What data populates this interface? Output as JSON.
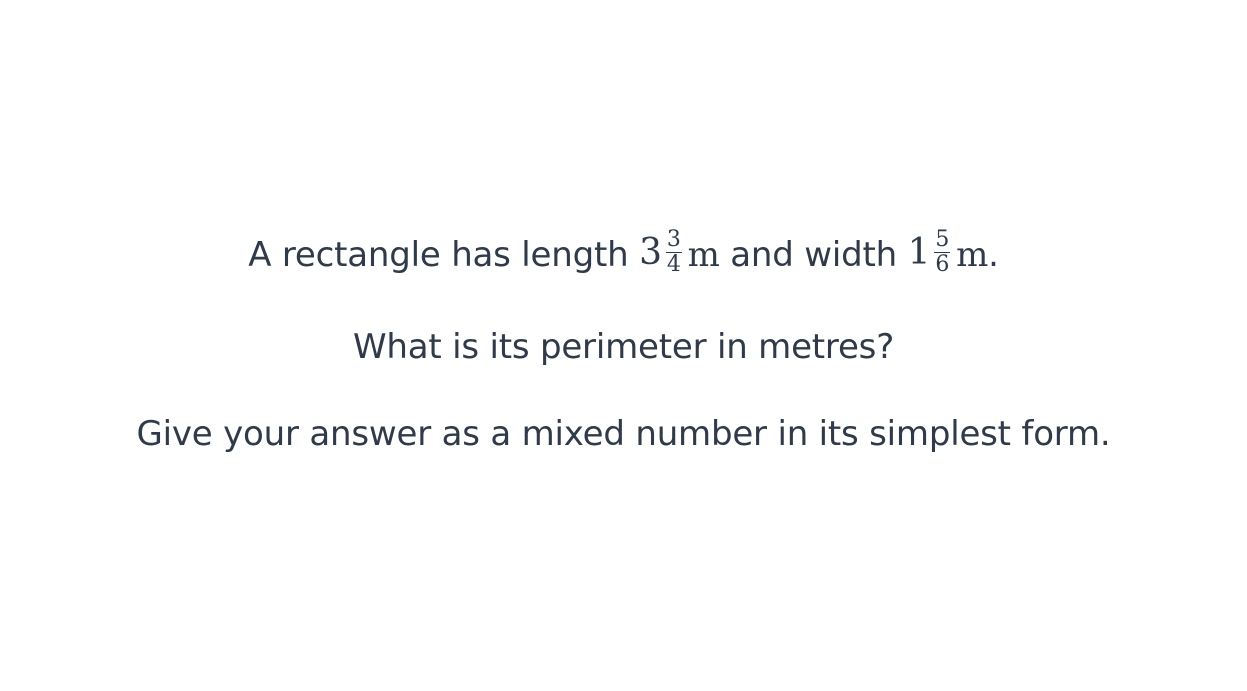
{
  "question": {
    "line1": {
      "prefix": "A rectangle has length",
      "length": {
        "whole": "3",
        "numerator": "3",
        "denominator": "4",
        "unit": "m"
      },
      "middle": "and width",
      "width": {
        "whole": "1",
        "numerator": "5",
        "denominator": "6",
        "unit": "m"
      },
      "suffix": "."
    },
    "line2": "What is its perimeter in metres?",
    "line3": "Give your answer as a mixed number in its simplest form."
  },
  "colors": {
    "text": "#2f3a4b",
    "background": "#ffffff"
  }
}
